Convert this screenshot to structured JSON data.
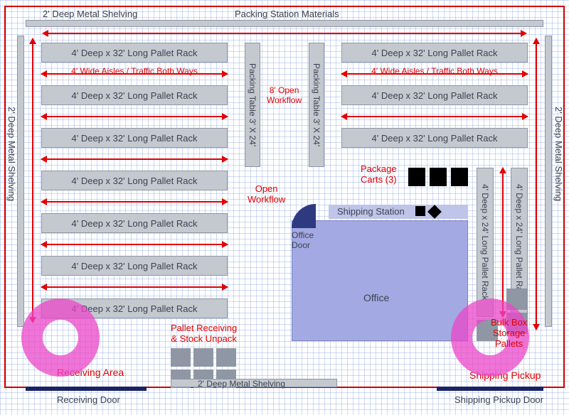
{
  "header": {
    "topShelving": "2' Deep Metal Shelving",
    "packingMaterials": "Packing Station Materials"
  },
  "sideShelvingLabel": "2' Deep Metal Shelving",
  "racks": {
    "leftLabel": "4' Deep x 32' Long Pallet Rack",
    "rightLabel": "4' Deep x 32' Long Pallet Rack",
    "rightVLabel": "4' Deep x 24' Long Pallet Rack"
  },
  "aisle": {
    "label": "4' Wide Aisles / Traffic Both Ways"
  },
  "packing": {
    "tableLabel": "Packing Table 3' X 24'",
    "openWorkflow8": "8' Open\nWorkflow",
    "openWorkflow": "Open\nWorkflow"
  },
  "shippingStation": "Shipping Station",
  "packageCarts": "Package\nCarts (3)",
  "office": {
    "label": "Office",
    "door": "Office\nDoor"
  },
  "bulk": "Bulk Box\nStorage\nPallets",
  "receiving": {
    "area": "Receiving Area",
    "pallet": "Pallet Receiving\n& Stock Unpack",
    "bottomShelving": "2' Deep Metal Shelving",
    "door": "Receiving Door"
  },
  "shipping": {
    "pickup": "Shipping Pickup",
    "door": "Shipping Pickup Door"
  }
}
